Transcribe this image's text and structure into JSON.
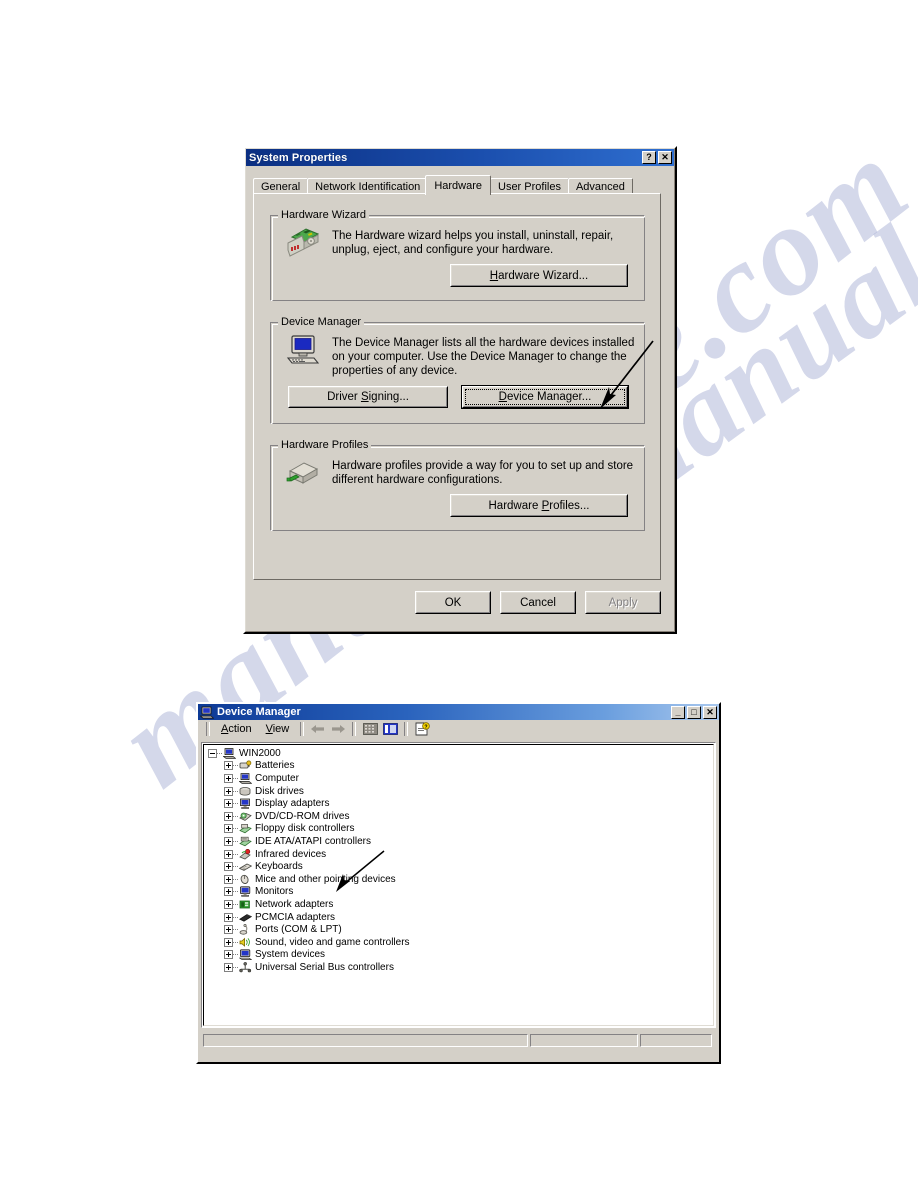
{
  "page": {
    "background": "#ffffff",
    "watermark_text": "manualshive.com"
  },
  "system_properties": {
    "title": "System Properties",
    "titlebar_buttons": [
      {
        "name": "help-button",
        "label": "?"
      },
      {
        "name": "close-button",
        "label": "✕"
      }
    ],
    "tabs": [
      {
        "label": "General",
        "active": false
      },
      {
        "label": "Network Identification",
        "active": false
      },
      {
        "label": "Hardware",
        "active": true
      },
      {
        "label": "User Profiles",
        "active": false
      },
      {
        "label": "Advanced",
        "active": false
      }
    ],
    "groups": [
      {
        "id": "hardware-wizard",
        "title": "Hardware Wizard",
        "icon": "circuit-board-device-icon",
        "description_line1": "The Hardware wizard helps you install, uninstall, repair,",
        "description_line2": "unplug, eject, and configure your hardware.",
        "button": {
          "name": "hardware-wizard-button",
          "label_pre": "",
          "label_accel": "H",
          "label_post": "ardware Wizard...",
          "label": "Hardware Wizard...",
          "disabled": false,
          "focused": false,
          "default": false
        }
      },
      {
        "id": "device-manager",
        "title": "Device Manager",
        "icon": "computer-monitor-icon",
        "description_line1": "The Device Manager lists all the hardware devices installed",
        "description_line2": "on your computer. Use the Device Manager to change the",
        "description_line3": "properties of any device.",
        "buttons": [
          {
            "name": "driver-signing-button",
            "label_pre": "Driver ",
            "label_accel": "S",
            "label_post": "igning...",
            "label": "Driver Signing...",
            "disabled": false,
            "focused": false,
            "default": false
          },
          {
            "name": "device-manager-button",
            "label_pre": "",
            "label_accel": "D",
            "label_post": "evice Manager...",
            "label": "Device Manager...",
            "disabled": false,
            "focused": true,
            "default": true
          }
        ]
      },
      {
        "id": "hardware-profiles",
        "title": "Hardware Profiles",
        "icon": "hardware-profile-box-icon",
        "description_line1": "Hardware profiles provide a way for you to set up and store",
        "description_line2": "different hardware configurations.",
        "button": {
          "name": "hardware-profiles-button",
          "label_pre": "Hardware ",
          "label_accel": "P",
          "label_post": "rofiles...",
          "label": "Hardware Profiles...",
          "disabled": false,
          "focused": false,
          "default": false
        }
      }
    ],
    "dialog_buttons": [
      {
        "name": "ok-button",
        "label": "OK",
        "disabled": false
      },
      {
        "name": "cancel-button",
        "label": "Cancel",
        "disabled": false
      },
      {
        "name": "apply-button",
        "label": "Apply",
        "disabled": true
      }
    ]
  },
  "device_manager_window": {
    "title": "Device Manager",
    "title_icon": "device-manager-icon",
    "titlebar_buttons": [
      {
        "name": "minimize-button",
        "label": "_"
      },
      {
        "name": "maximize-button",
        "label": "□"
      },
      {
        "name": "close-button",
        "label": "✕"
      }
    ],
    "menus": [
      {
        "name": "menu-action",
        "label_pre": "",
        "label_accel": "A",
        "label_post": "ction",
        "label": "Action"
      },
      {
        "name": "menu-view",
        "label_pre": "",
        "label_accel": "V",
        "label_post": "iew",
        "label": "View"
      }
    ],
    "toolbar_icons": [
      {
        "name": "back-arrow-icon",
        "glyph": "←",
        "disabled": true
      },
      {
        "name": "forward-arrow-icon",
        "glyph": "→",
        "disabled": true
      },
      {
        "name": "show-hidden-devices-icon",
        "glyph": "",
        "disabled": false
      },
      {
        "name": "properties-view-icon",
        "glyph": "",
        "disabled": false
      },
      {
        "name": "scan-hardware-icon",
        "glyph": "",
        "disabled": false
      }
    ],
    "tree": {
      "root": {
        "label": "WIN2000",
        "icon": "computer-icon",
        "expanded": true
      },
      "items": [
        {
          "label": "Batteries",
          "icon": "battery-icon"
        },
        {
          "label": "Computer",
          "icon": "computer-icon"
        },
        {
          "label": "Disk drives",
          "icon": "disk-drive-icon"
        },
        {
          "label": "Display adapters",
          "icon": "display-adapter-icon"
        },
        {
          "label": "DVD/CD-ROM drives",
          "icon": "cdrom-icon"
        },
        {
          "label": "Floppy disk controllers",
          "icon": "floppy-controller-icon"
        },
        {
          "label": "IDE ATA/ATAPI controllers",
          "icon": "ide-controller-icon"
        },
        {
          "label": "Infrared devices",
          "icon": "infrared-icon"
        },
        {
          "label": "Keyboards",
          "icon": "keyboard-icon"
        },
        {
          "label": "Mice and other pointing devices",
          "icon": "mouse-icon"
        },
        {
          "label": "Monitors",
          "icon": "monitor-icon"
        },
        {
          "label": "Network adapters",
          "icon": "network-adapter-icon"
        },
        {
          "label": "PCMCIA adapters",
          "icon": "pcmcia-icon"
        },
        {
          "label": "Ports (COM & LPT)",
          "icon": "port-icon"
        },
        {
          "label": "Sound, video and game controllers",
          "icon": "sound-icon"
        },
        {
          "label": "System devices",
          "icon": "system-device-icon"
        },
        {
          "label": "Universal Serial Bus controllers",
          "icon": "usb-icon"
        }
      ]
    },
    "statusbar_panes": [
      "",
      "",
      ""
    ]
  },
  "annotations": [
    {
      "name": "arrow-to-device-manager-button",
      "points_to": "device-manager-button"
    },
    {
      "name": "arrow-to-network-adapters",
      "points_to": "tree-item-monitors"
    }
  ]
}
